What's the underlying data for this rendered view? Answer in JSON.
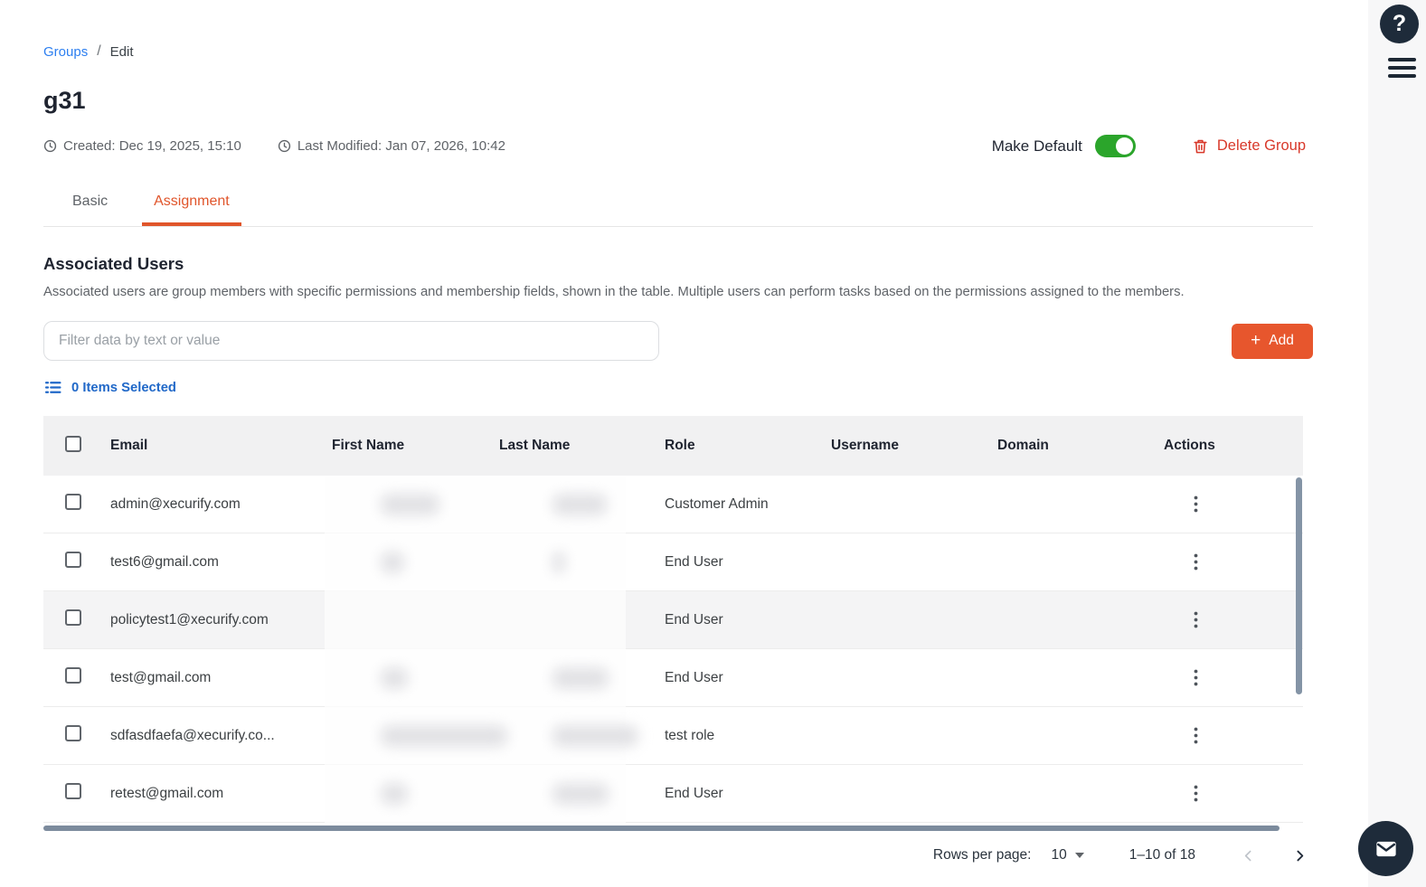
{
  "colors": {
    "accent_orange": "#e7562d",
    "active_tab_orange": "#e0552b",
    "toggle_green": "#2ba52b",
    "delete_red": "#d8382a",
    "link_blue": "#2d7ff0",
    "selected_blue": "#2068c8",
    "navy_fab": "#1e2b3a",
    "table_header_bg": "#f1f1f2",
    "row_highlight_bg": "#f4f4f5",
    "scrollbar": "#7c8b9d"
  },
  "topbar": {
    "help_glyph": "?"
  },
  "breadcrumb": {
    "link": "Groups",
    "separator": "/",
    "current": "Edit"
  },
  "group": {
    "name": "g31",
    "created": "Created: Dec 19, 2025, 15:10",
    "last_modified": "Last Modified: Jan 07, 2026, 10:42"
  },
  "header_actions": {
    "make_default_label": "Make Default",
    "make_default_on": true,
    "delete_group_label": "Delete Group"
  },
  "tabs": [
    {
      "label": "Basic",
      "active": false
    },
    {
      "label": "Assignment",
      "active": true
    }
  ],
  "section": {
    "title": "Associated Users",
    "description": "Associated users are group members with specific permissions and membership fields, shown in the table. Multiple users can perform tasks based on the permissions assigned to the members."
  },
  "toolbar": {
    "filter_placeholder": "Filter data by text or value",
    "add_plus": "+",
    "add_label": "Add",
    "items_selected": "0 Items Selected"
  },
  "table": {
    "columns": [
      "Email",
      "First Name",
      "Last Name",
      "Role",
      "Username",
      "Domain",
      "Actions"
    ],
    "rows": [
      {
        "email": "admin@xecurify.com",
        "role": "Customer Admin",
        "username": "",
        "domain": "",
        "highlight": false,
        "first_name_blur_w": 65,
        "last_name_blur_w": 60
      },
      {
        "email": "test6@gmail.com",
        "role": "End User",
        "username": "",
        "domain": "",
        "highlight": false,
        "first_name_blur_w": 26,
        "last_name_blur_w": 14
      },
      {
        "email": "policytest1@xecurify.com",
        "role": "End User",
        "username": "",
        "domain": "",
        "highlight": true,
        "first_name_blur_w": 0,
        "last_name_blur_w": 0
      },
      {
        "email": "test@gmail.com",
        "role": "End User",
        "username": "",
        "domain": "",
        "highlight": false,
        "first_name_blur_w": 30,
        "last_name_blur_w": 62
      },
      {
        "email": "sdfasdfaefa@xecurify.co...",
        "role": "test role",
        "username": "",
        "domain": "",
        "highlight": false,
        "first_name_blur_w": 140,
        "last_name_blur_w": 95
      },
      {
        "email": "retest@gmail.com",
        "role": "End User",
        "username": "",
        "domain": "",
        "highlight": false,
        "first_name_blur_w": 30,
        "last_name_blur_w": 62
      }
    ]
  },
  "pagination": {
    "rows_per_page_label": "Rows per page:",
    "rows_per_page_value": "10",
    "range": "1–10 of 18"
  }
}
